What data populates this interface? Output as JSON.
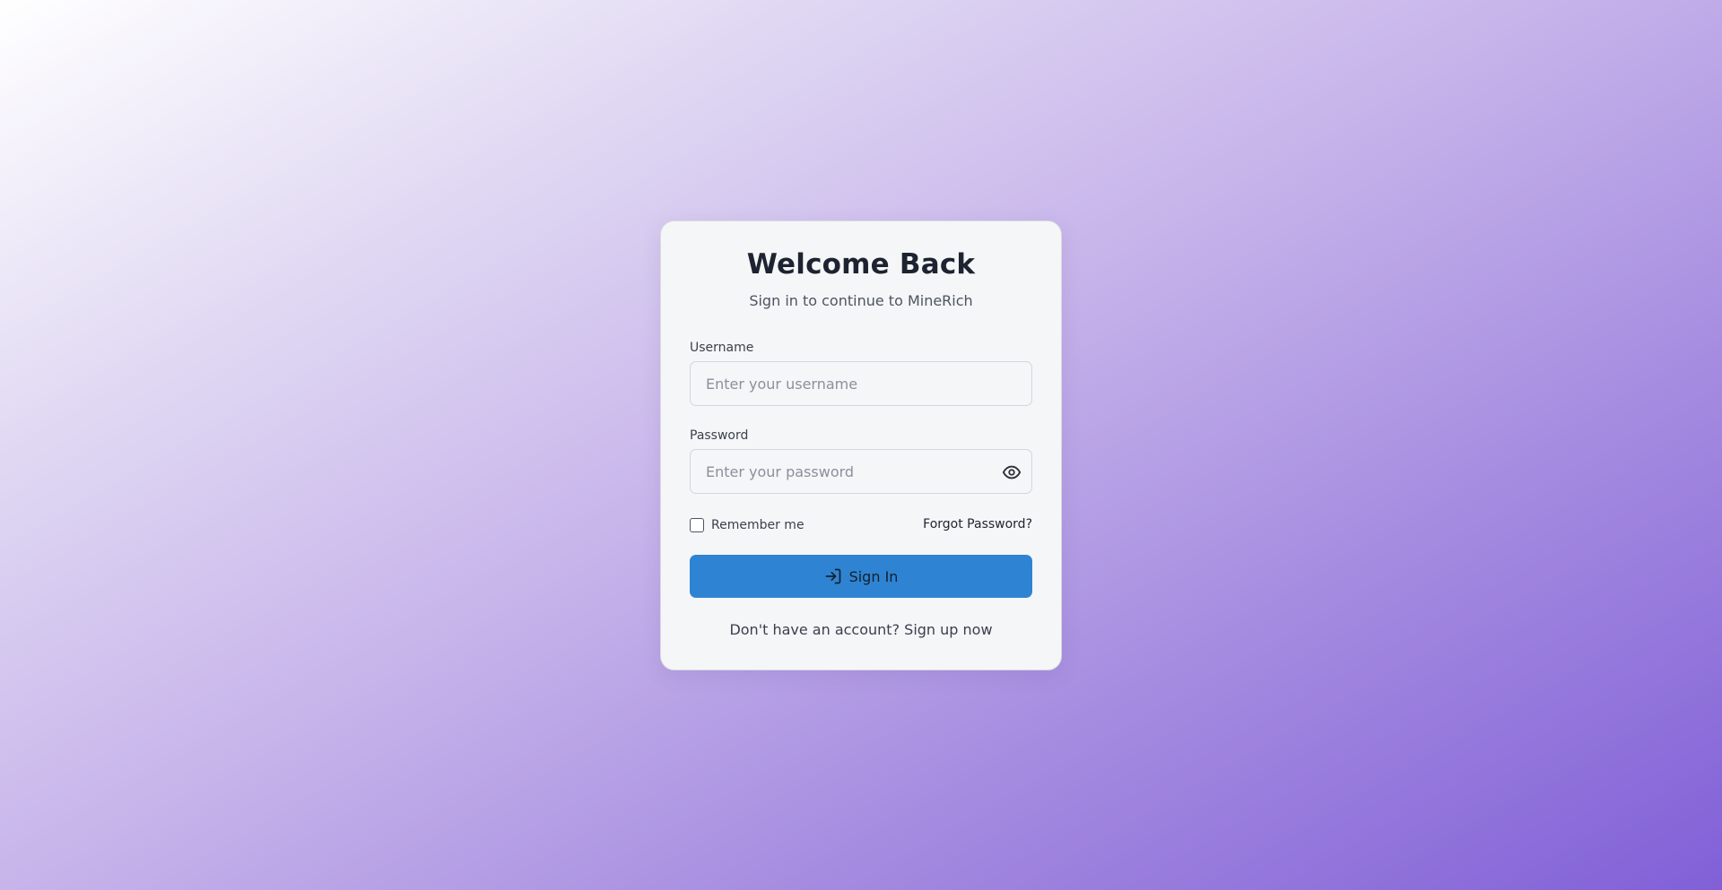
{
  "login": {
    "title": "Welcome Back",
    "subtitle": "Sign in to continue to MineRich",
    "username": {
      "label": "Username",
      "placeholder": "Enter your username",
      "value": ""
    },
    "password": {
      "label": "Password",
      "placeholder": "Enter your password",
      "value": "",
      "toggle_icon": "eye-icon"
    },
    "remember": {
      "label": "Remember me",
      "checked": false
    },
    "forgot_label": "Forgot Password?",
    "signin_label": "Sign In",
    "signin_icon": "sign-in-icon",
    "signup_prompt": "Don't have an account?",
    "signup_link": "Sign up now"
  },
  "colors": {
    "primary_button": "#2e84d2",
    "card_background": "#f5f6f8",
    "background_start": "#ffffff",
    "background_end": "#8160d7"
  }
}
